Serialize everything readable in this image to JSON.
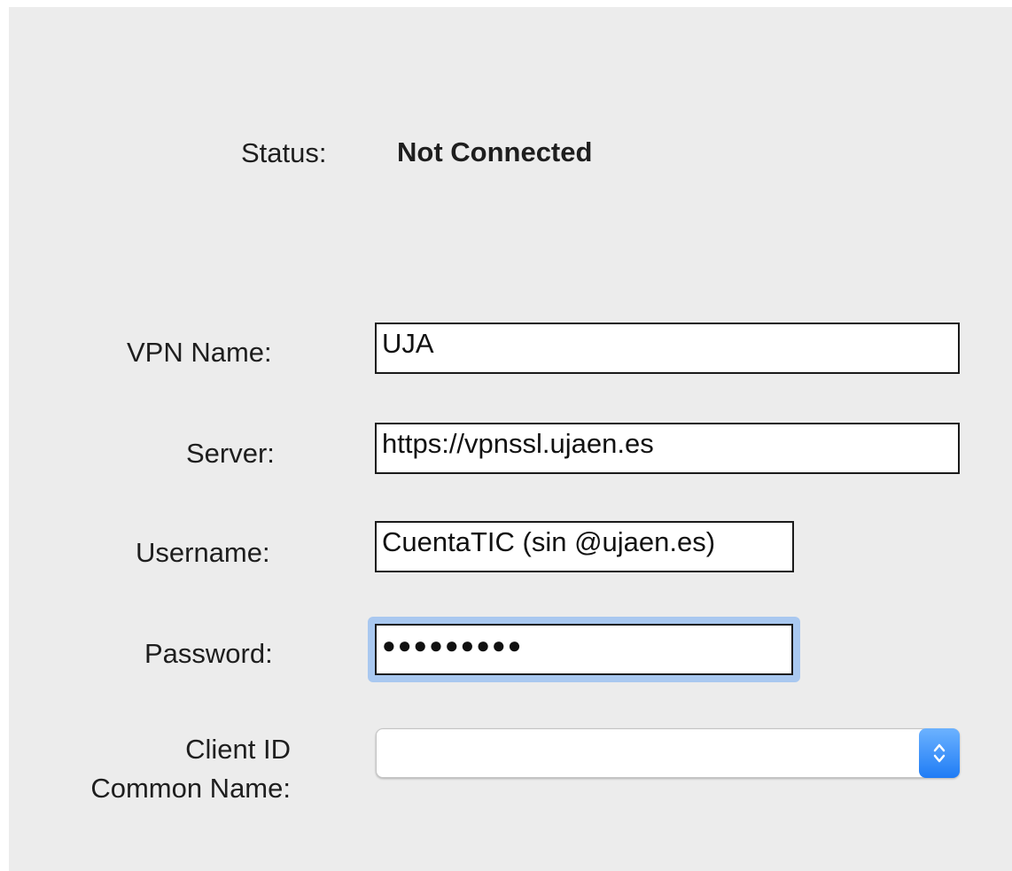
{
  "status": {
    "label": "Status:",
    "value": "Not Connected"
  },
  "form": {
    "vpn_name": {
      "label": "VPN Name:",
      "value": "UJA"
    },
    "server": {
      "label": "Server:",
      "value": "https://vpnssl.ujaen.es"
    },
    "username": {
      "label": "Username:",
      "value": "CuentaTIC (sin @ujaen.es)"
    },
    "password": {
      "label": "Password:",
      "masked_value": "●●●●●●●●●"
    },
    "client_id": {
      "label_line1": "Client ID",
      "label_line2": "Common Name:",
      "selected": ""
    }
  },
  "colors": {
    "panel_bg": "#ececec",
    "focus_ring": "#a9c8f0",
    "select_accent": "#1f7cf5"
  },
  "icons": {
    "select_arrows": "chevron-up-down-icon"
  }
}
